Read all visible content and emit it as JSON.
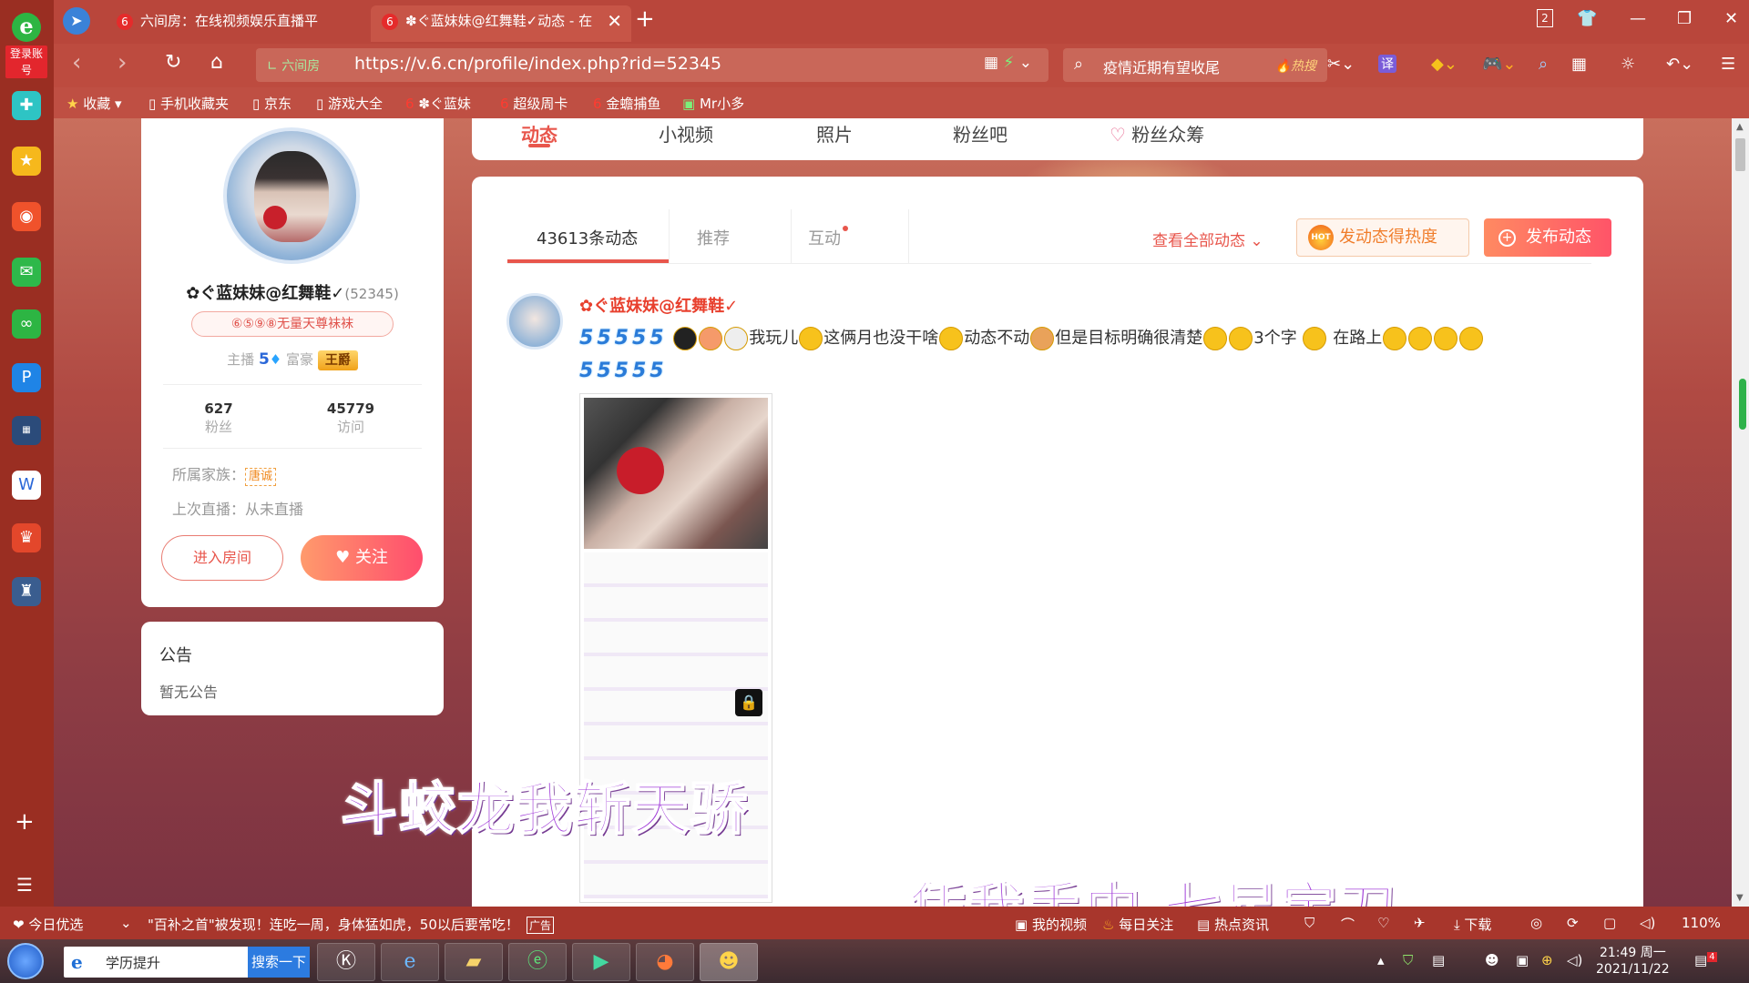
{
  "browser": {
    "tabs": [
      {
        "label": "六间房：在线视频娱乐直播平"
      },
      {
        "label": "✽ぐ蓝妹妹@红舞鞋✓动态 - 在"
      }
    ],
    "url_prefix": "六间房",
    "url": "https://v.6.cn/profile/index.php?rid=52345",
    "search_text": "疫情近期有望收尾",
    "search_hot": "热搜",
    "tab_count": "2",
    "translate_label": "译",
    "bookmarks": [
      {
        "label": "收藏"
      },
      {
        "label": "手机收藏夹"
      },
      {
        "label": "京东"
      },
      {
        "label": "游戏大全"
      },
      {
        "label": "✽ぐ蓝妹"
      },
      {
        "label": "超级周卡"
      },
      {
        "label": "金蟾捕鱼"
      },
      {
        "label": "Mr小多"
      }
    ]
  },
  "sidebar": {
    "login_label": "登录账号"
  },
  "profile": {
    "nickname": "✿ぐ蓝妹妹@红舞鞋✓",
    "rid": "(52345)",
    "medal": "⑥⑤⑨⑧无量天尊袜袜",
    "anchor_label": "主播",
    "anchor_level": "5",
    "rich_label": "富豪",
    "rich_badge": "王爵",
    "fans_count": "627",
    "fans_label": "粉丝",
    "visits_count": "45779",
    "visits_label": "访问",
    "family_label": "所属家族：",
    "family_tag": "唐诚",
    "last_live": "上次直播：从未直播",
    "enter_room": "进入房间",
    "follow": "关注"
  },
  "notice": {
    "title": "公告",
    "body": "暂无公告"
  },
  "page_tabs": [
    {
      "label": "动态"
    },
    {
      "label": "小视频"
    },
    {
      "label": "照片"
    },
    {
      "label": "粉丝吧"
    },
    {
      "label": "粉丝众筹"
    }
  ],
  "feed": {
    "subtabs": [
      {
        "label": "43613条动态"
      },
      {
        "label": "推荐"
      },
      {
        "label": "互动"
      }
    ],
    "view_all": "查看全部动态",
    "hot_button": "发动态得热度",
    "hot_badge": "HOT",
    "post_button": "发布动态",
    "post": {
      "author": "✿ぐ蓝妹妹@红舞鞋✓",
      "vip_mark": "5",
      "text_1": "我玩儿",
      "text_2": "这俩月也没干啥",
      "text_3": "动态不动",
      "text_4": "但是目标明确很清楚",
      "text_5": "3个字 ",
      "text_6": " 在路上"
    }
  },
  "lyrics": {
    "line_1": "斗蛟龙我斩天骄",
    "line_2": "凭我手中  七星宝刀"
  },
  "statusbar": {
    "left_label": "今日优选",
    "ad_text": "\"百补之首\"被发现！连吃一周，身体猛如虎，50以后要常吃！",
    "ad_tag": "广告",
    "my_video": "我的视频",
    "daily_follow": "每日关注",
    "hot_news": "热点资讯",
    "download": "下载",
    "zoom": "110%"
  },
  "taskbar": {
    "search_text": "学历提升",
    "search_button": "搜索一下",
    "time": "21:49 周一",
    "date": "2021/11/22",
    "notif_count": "4"
  },
  "colors": {
    "accent": "#e8564c",
    "browser_red": "#b9463b",
    "link_blue": "#2a67d8"
  }
}
